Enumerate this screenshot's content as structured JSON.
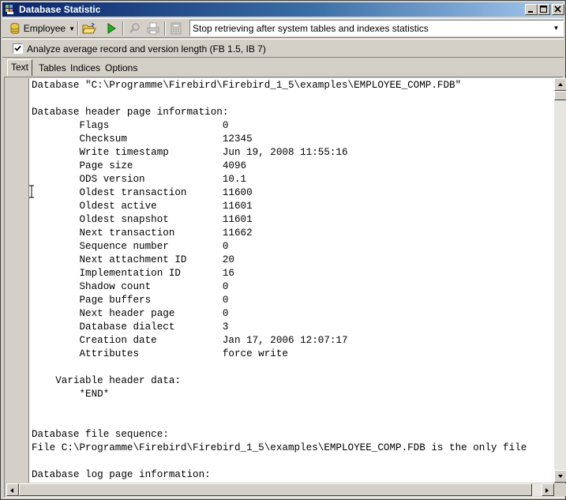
{
  "window": {
    "title": "Database Statistic",
    "icon": "database-statistic-icon"
  },
  "toolbar": {
    "database": "Employee",
    "icons": [
      "database-icon",
      "open-folder-icon",
      "run-icon",
      "search-icon",
      "print-icon",
      "calculator-icon"
    ],
    "retrieve_option": "Stop retrieving after system tables and indexes statistics"
  },
  "options": {
    "analyze_checked": true,
    "analyze_label": "Analyze average record and version length (FB 1.5, IB 7)"
  },
  "tabs": [
    {
      "label": "Text",
      "active": true
    },
    {
      "label": "Tables",
      "active": false
    },
    {
      "label": "Indices",
      "active": false
    },
    {
      "label": "Options",
      "active": false
    }
  ],
  "text_lines": [
    "Database \"C:\\Programme\\Firebird\\Firebird_1_5\\examples\\EMPLOYEE_COMP.FDB\"",
    "",
    "Database header page information:",
    "        Flags                   0",
    "        Checksum                12345",
    "        Write timestamp         Jun 19, 2008 11:55:16",
    "        Page size               4096",
    "        ODS version             10.1",
    "        Oldest transaction      11600",
    "        Oldest active           11601",
    "        Oldest snapshot         11601",
    "        Next transaction        11662",
    "        Sequence number         0",
    "        Next attachment ID      20",
    "        Implementation ID       16",
    "        Shadow count            0",
    "        Page buffers            0",
    "        Next header page        0",
    "        Database dialect        3",
    "        Creation date           Jan 17, 2006 12:07:17",
    "        Attributes              force write",
    "",
    "    Variable header data:",
    "        *END*",
    "",
    "",
    "Database file sequence:",
    "File C:\\Programme\\Firebird\\Firebird_1_5\\examples\\EMPLOYEE_COMP.FDB is the only file",
    "",
    "Database log page information:"
  ]
}
